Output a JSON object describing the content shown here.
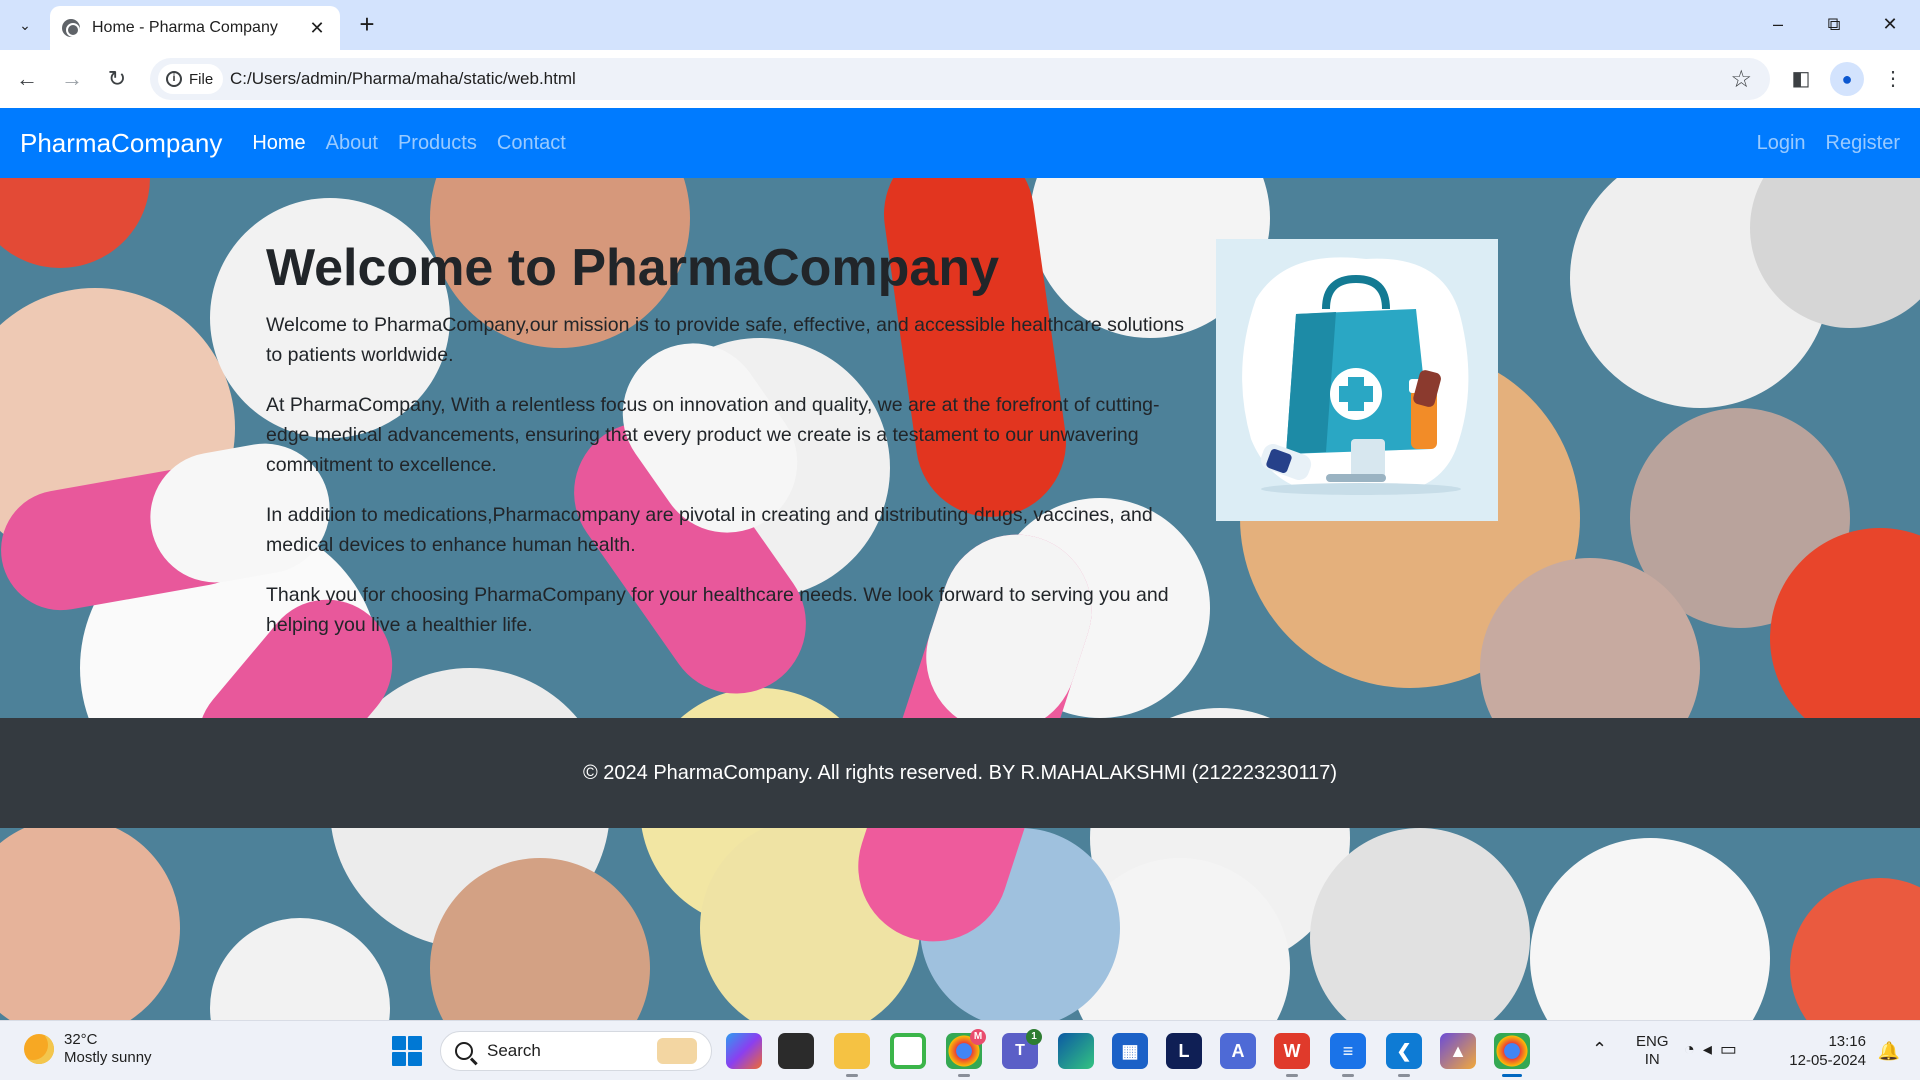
{
  "browser": {
    "tab_title": "Home - Pharma Company",
    "new_tab_symbol": "+",
    "close_tab_symbol": "✕",
    "chip_label": "File",
    "url": "C:/Users/admin/Pharma/maha/static/web.html"
  },
  "site": {
    "brand": "PharmaCompany",
    "nav": [
      "Home",
      "About",
      "Products",
      "Contact"
    ],
    "active_nav": "Home",
    "auth": [
      "Login",
      "Register"
    ],
    "title": "Welcome to PharmaCompany",
    "paragraphs": [
      "Welcome to PharmaCompany,our mission is to provide safe, effective, and accessible healthcare solutions to patients worldwide.",
      "At PharmaCompany, With a relentless focus on innovation and quality, we are at the forefront of cutting-edge medical advancements, ensuring that every product we create is a testament to our unwavering commitment to excellence.",
      "In addition to medications,Pharmacompany are pivotal in creating and distributing drugs, vaccines, and medical devices to enhance human health.",
      "Thank you for choosing PharmaCompany for your healthcare needs. We look forward to serving you and helping you live a healthier life."
    ],
    "footer": "© 2024 PharmaCompany. All rights reserved. BY R.MAHALAKSHMI (212223230117)"
  },
  "taskbar": {
    "weather_temp": "32°C",
    "weather_desc": "Mostly sunny",
    "search_label": "Search",
    "lang_line1": "ENG",
    "lang_line2": "IN",
    "time": "13:16",
    "date": "12-05-2024",
    "badges": {
      "chrome_profile": "M",
      "teams": "1"
    }
  },
  "colors": {
    "site_nav": "#007bff",
    "footer": "#343a40",
    "tab_strip": "#d3e3fd"
  }
}
